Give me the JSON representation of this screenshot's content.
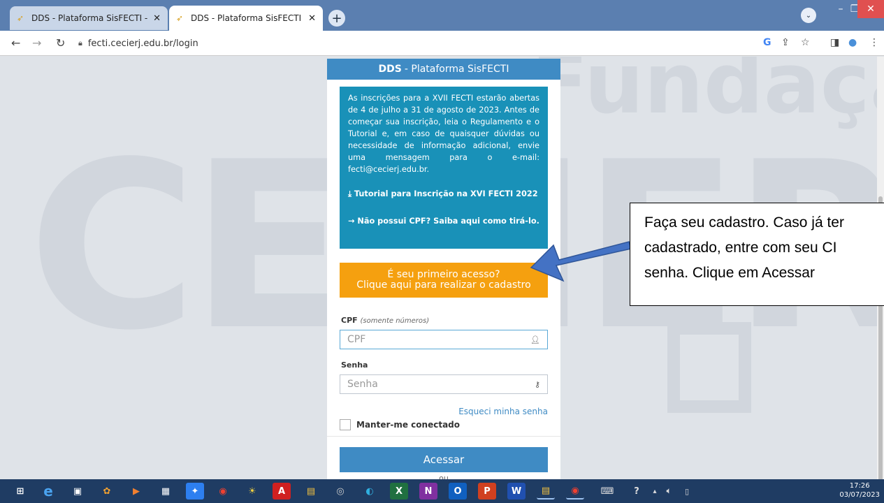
{
  "browser": {
    "tabs": [
      {
        "title": "DDS - Plataforma SisFECTI - Logi",
        "close": "✕",
        "active": false
      },
      {
        "title": "DDS - Plataforma SisFECTI - Logi",
        "close": "✕",
        "active": true
      }
    ],
    "new_tab": "+",
    "url": "fecti.cecierj.edu.br/login"
  },
  "background": {
    "watermark_top": "Fundação",
    "watermark_main": "CECIERJ"
  },
  "panel": {
    "header_bold": "DDS",
    "header_rest": "- Plataforma SisFECTI",
    "info_message": "As inscrições para a XVII FECTI estarão abertas de 4 de julho a 31 de agosto de 2023. Antes de começar sua inscrição, leia o Regulamento e o Tutorial e, em caso de quaisquer dúvidas ou necessidade de informação adicional, envie uma mensagem para o e-mail: fecti@cecierj.edu.br.",
    "tutorial_link": "⤓ Tutorial para Inscrição na XVI FECTI 2022",
    "cpf_help_link": "→ Não possui CPF? Saiba aqui como tirá-lo.",
    "cta_line1": "É seu primeiro acesso?",
    "cta_line2": "Clique aqui para realizar o cadastro",
    "cpf_label": "CPF",
    "cpf_hint": "(somente números)",
    "cpf_placeholder": "CPF",
    "senha_label": "Senha",
    "senha_placeholder": "Senha",
    "forgot": "Esqueci minha senha",
    "keep": "Manter-me conectado",
    "submit": "Acessar",
    "or": "ou"
  },
  "callout": {
    "line1": "Faça seu cadastro. Caso já ter",
    "line2": "cadastrado, entre com seu CI",
    "line3": "senha. Clique em Acessar"
  },
  "taskbar": {
    "time": "17:26",
    "date": "03/07/2023"
  },
  "colors": {
    "header_blue": "#3f8bc4",
    "info_teal": "#1991b8",
    "cta_orange": "#f5a00f",
    "arrow_blue": "#4472c4"
  }
}
